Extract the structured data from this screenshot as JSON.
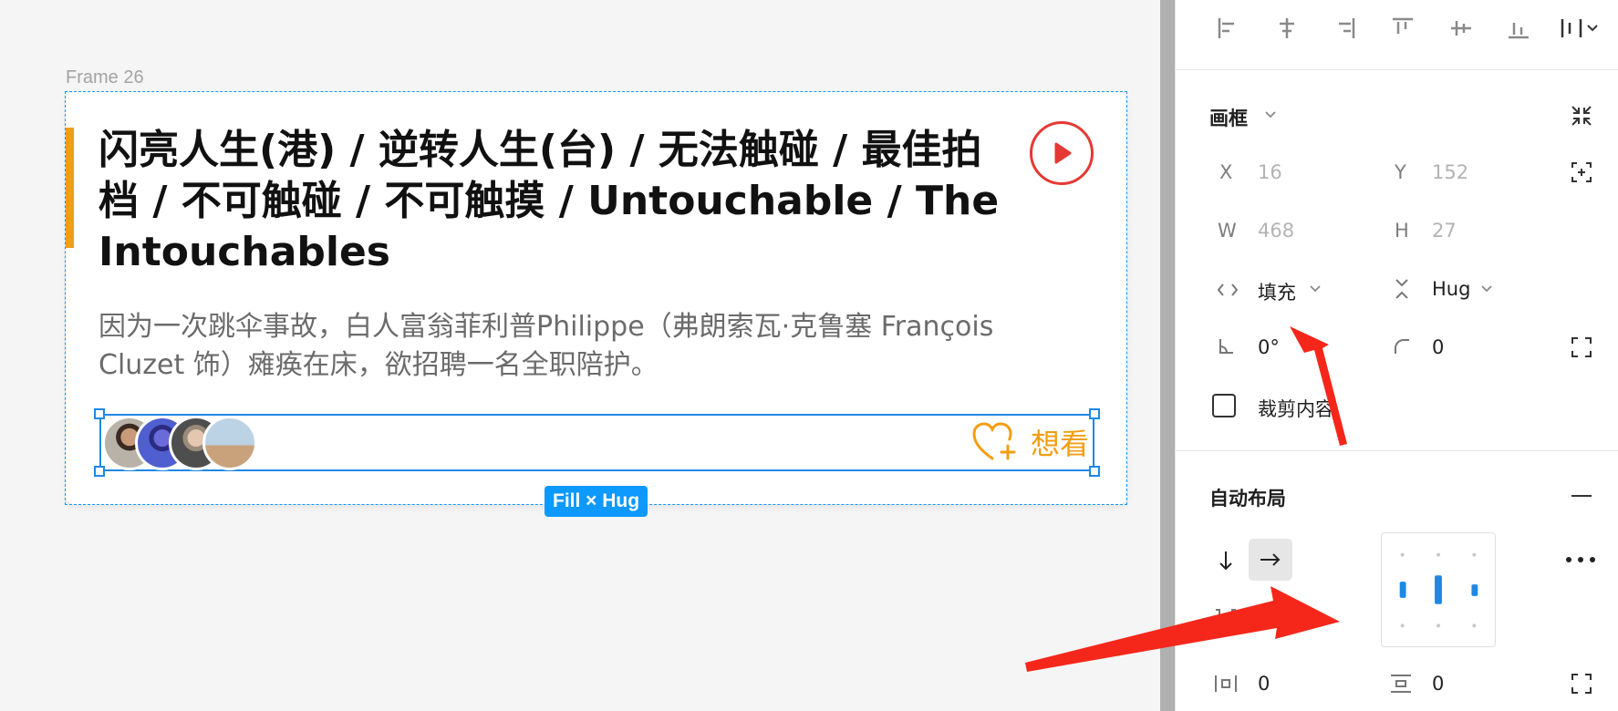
{
  "canvas": {
    "frame_label": "Frame 26",
    "card": {
      "title": "闪亮人生(港) / 逆转人生(台) / 无法触碰 / 最佳拍档 / 不可触碰 / 不可触摸 / Untouchable / The Intouchables",
      "description": "因为一次跳伞事故，白人富翁菲利普Philippe（弗朗索瓦·克鲁塞 François Cluzet 饰）瘫痪在床，欲招聘一名全职陪护。",
      "want_label": "想看",
      "avatar_count": 4
    },
    "size_badge": "Fill × Hug",
    "colors": {
      "accent": "#f29e12",
      "play": "#e53935",
      "selection": "#0d99ff",
      "arrow": "#f5271b"
    }
  },
  "panel": {
    "frame_section": {
      "title": "画框",
      "x_label": "X",
      "x_value": "16",
      "y_label": "Y",
      "y_value": "152",
      "w_label": "W",
      "w_value": "468",
      "h_label": "H",
      "h_value": "27",
      "horizontal_sizing": "填充",
      "vertical_sizing": "Hug",
      "rotation": "0°",
      "corner_radius": "0",
      "clip_content": "裁剪内容"
    },
    "auto_layout": {
      "title": "自动布局",
      "spacing_mode": "Auto",
      "padding_horizontal": "0",
      "padding_vertical": "0"
    }
  }
}
